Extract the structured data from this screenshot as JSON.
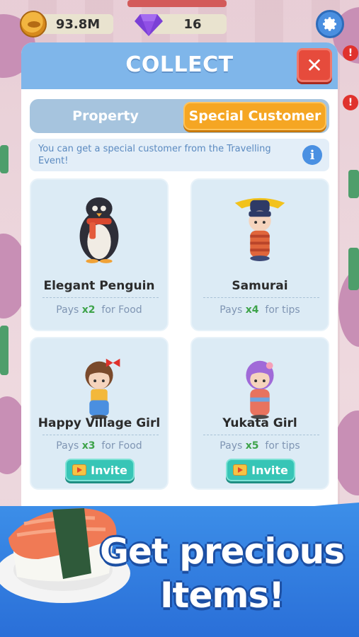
{
  "currency": {
    "coins": "93.8M",
    "gems": "16"
  },
  "icons": {
    "coin": "coin-icon",
    "gem": "gem-icon",
    "settings": "gear-icon",
    "close": "close-icon",
    "info": "info-icon",
    "invite": "tv-video-icon",
    "alert": "exclamation-icon"
  },
  "side_badges": [
    "!",
    "!"
  ],
  "modal": {
    "title": "COLLECT",
    "close_label": "✕",
    "tabs": [
      {
        "label": "Property",
        "selected": false
      },
      {
        "label": "Special Customer",
        "selected": true
      }
    ],
    "info_text": "You can get a special customer from the Travelling Event!",
    "info_icon_label": "i",
    "cards": [
      {
        "name": "Elegant Penguin",
        "pays_prefix": "Pays",
        "multiplier": "x2",
        "pays_suffix": "for Food",
        "invite": ""
      },
      {
        "name": "Samurai",
        "pays_prefix": "Pays",
        "multiplier": "x4",
        "pays_suffix": "for tips",
        "invite": ""
      },
      {
        "name": "Happy Village Girl",
        "pays_prefix": "Pays",
        "multiplier": "x3",
        "pays_suffix": "for Food",
        "invite": "Invite"
      },
      {
        "name": "Yukata Girl",
        "pays_prefix": "Pays",
        "multiplier": "x5",
        "pays_suffix": "for tips",
        "invite": "Invite"
      }
    ]
  },
  "promo": {
    "line1": "Get precious",
    "line2": "Items!"
  },
  "colors": {
    "header": "#7fb6ea",
    "tab_active": "#f5a623",
    "close": "#e64b3c",
    "invite": "#37c5b6",
    "multiplier": "#3ea34a",
    "banner": "#2a6fd8"
  }
}
